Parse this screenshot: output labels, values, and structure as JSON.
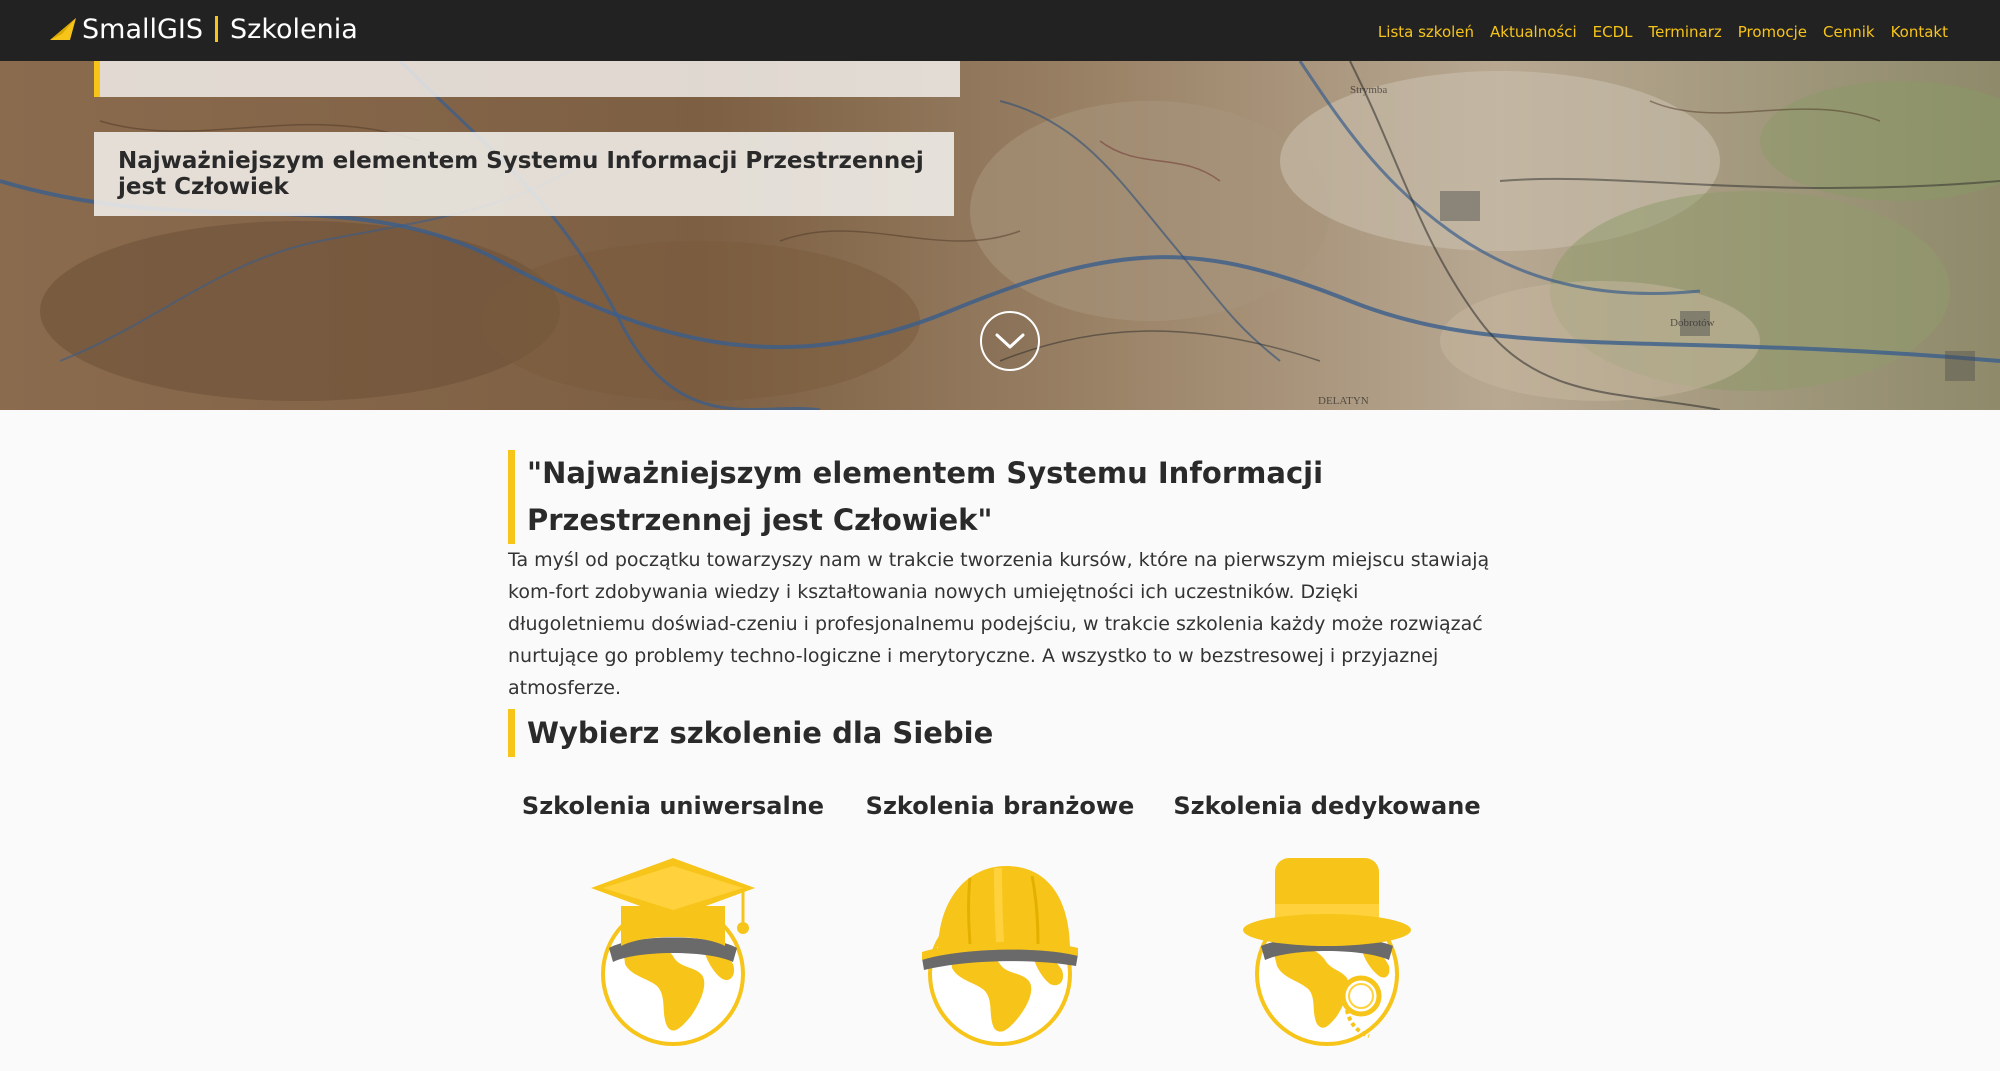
{
  "brand": {
    "name": "SmallGIS",
    "subtitle": "Szkolenia"
  },
  "nav": {
    "items": [
      "Lista szkoleń",
      "Aktualności",
      "ECDL",
      "Terminarz",
      "Promocje",
      "Cennik",
      "Kontakt"
    ]
  },
  "hero": {
    "card_text": "Najważniejszym elementem Systemu Informacji Przestrzennej jest Człowiek",
    "map_labels": [
      "Strymba",
      "Dobrotów",
      "DELATYN"
    ]
  },
  "main": {
    "quote_heading": "\"Najważniejszym elementem Systemu Informacji Przestrzennej jest Człowiek\"",
    "intro": "Ta myśl od początku towarzyszy nam w trakcie tworzenia kursów, które na pierwszym miejscu stawiają kom-fort zdobywania wiedzy i kształtowania nowych umiejętności ich uczestników. Dzięki długoletniemu doświad-czeniu i profesjonalnemu podejściu, w trakcie szkolenia każdy może rozwiązać nurtujące go problemy techno-logiczne i merytoryczne. A wszystko to w bezstresowej i przyjaznej atmosferze.",
    "section_heading": "Wybierz szkolenie dla Siebie",
    "cards": [
      {
        "title": "Szkolenia uniwersalne",
        "icon": "graduation-cap-globe-icon"
      },
      {
        "title": "Szkolenia branżowe",
        "icon": "hard-hat-globe-icon"
      },
      {
        "title": "Szkolenia dedykowane",
        "icon": "bowler-hat-monocle-globe-icon"
      }
    ]
  },
  "colors": {
    "accent": "#f7c41a",
    "navbar": "#222222",
    "background": "#fafafa",
    "text": "#2a2a2a"
  }
}
